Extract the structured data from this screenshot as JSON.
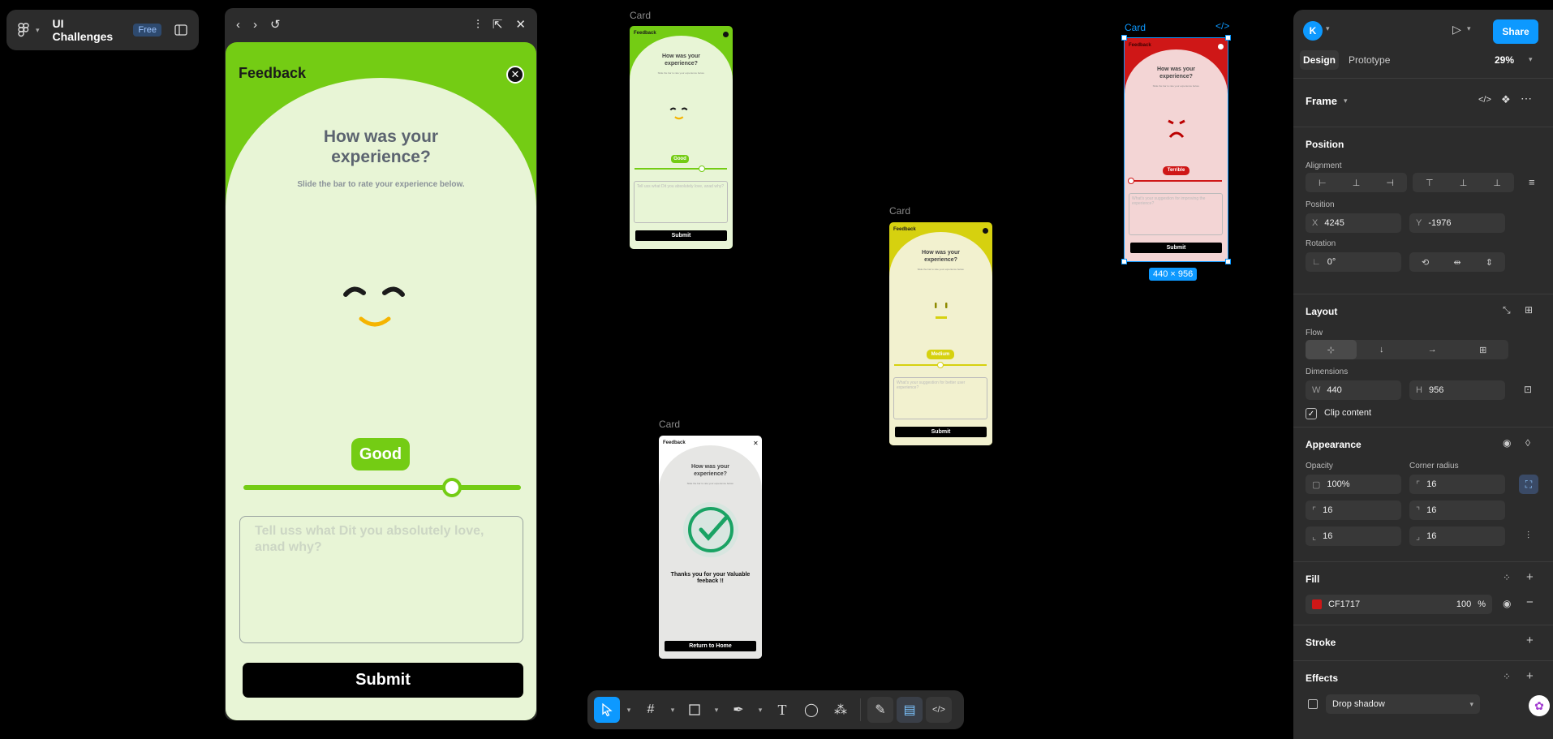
{
  "file": {
    "name": "UI Challenges",
    "badge": "Free"
  },
  "preview": {
    "card_title": "Feedback",
    "question": "How was your experience?",
    "subtitle": "Slide the bar to rate your experience below.",
    "rating_label": "Good",
    "rating_value": 0.75,
    "textarea_placeholder": "Tell uss what Dit you absolutely love, anad why?",
    "submit_label": "Submit"
  },
  "canvas": {
    "artboards": [
      {
        "label": "Card",
        "title": "Feedback",
        "question": "How was your experience?",
        "subtitle": "Slide the bar to rate your experience below.",
        "rating": "Good",
        "placeholder": "Tell uss what Dit you absolutely love, anad why?",
        "button": "Submit"
      },
      {
        "label": "Card",
        "title": "Feedback",
        "question": "How was your experience?",
        "subtitle": "Slide the bar to rate your experience below.",
        "rating": "Medium",
        "placeholder": "What's your suggestion for better user experience?",
        "button": "Submit"
      },
      {
        "label": "Card",
        "title": "Feedback",
        "question": "How was your experience?",
        "subtitle": "Slide the bar to rate your experience below.",
        "thanks": "Thanks you for your Valuable feeback !!",
        "button": "Return to Home"
      },
      {
        "label": "Card",
        "title": "Feedback",
        "question": "How was your experience?",
        "subtitle": "Slide the bar to rate your experience below.",
        "rating": "Terrible",
        "placeholder": "What's your suggestion for improving the experience?",
        "button": "Submit"
      }
    ],
    "selection_size": "440 × 956"
  },
  "toolbar": {
    "tools": [
      "move-tool",
      "frame-tool",
      "rectangle-tool",
      "pen-tool",
      "text-tool",
      "comment-tool",
      "actions-tool",
      "draw-mode",
      "design-mode",
      "dev-mode"
    ]
  },
  "panel": {
    "avatar": "K",
    "share": "Share",
    "tabs": {
      "design": "Design",
      "prototype": "Prototype"
    },
    "zoom": "29%",
    "frame_label": "Frame",
    "position": {
      "title": "Position",
      "alignment": "Alignment",
      "position_label": "Position",
      "x_key": "X",
      "x": "4245",
      "y_key": "Y",
      "y": "-1976",
      "rotation_label": "Rotation",
      "rotation": "0°"
    },
    "layout": {
      "title": "Layout",
      "flow": "Flow",
      "dimensions": "Dimensions",
      "w_key": "W",
      "w": "440",
      "h_key": "H",
      "h": "956",
      "clip": "Clip content"
    },
    "appearance": {
      "title": "Appearance",
      "opacity_label": "Opacity",
      "opacity": "100%",
      "radius_label": "Corner radius",
      "radius": "16",
      "r_tl": "16",
      "r_tr": "16",
      "r_bl": "16",
      "r_br": "16"
    },
    "fill": {
      "title": "Fill",
      "hex": "CF1717",
      "color": "#CF1717",
      "opacity": "100",
      "pct": "%"
    },
    "stroke": {
      "title": "Stroke"
    },
    "effects": {
      "title": "Effects",
      "effect": "Drop shadow"
    }
  }
}
